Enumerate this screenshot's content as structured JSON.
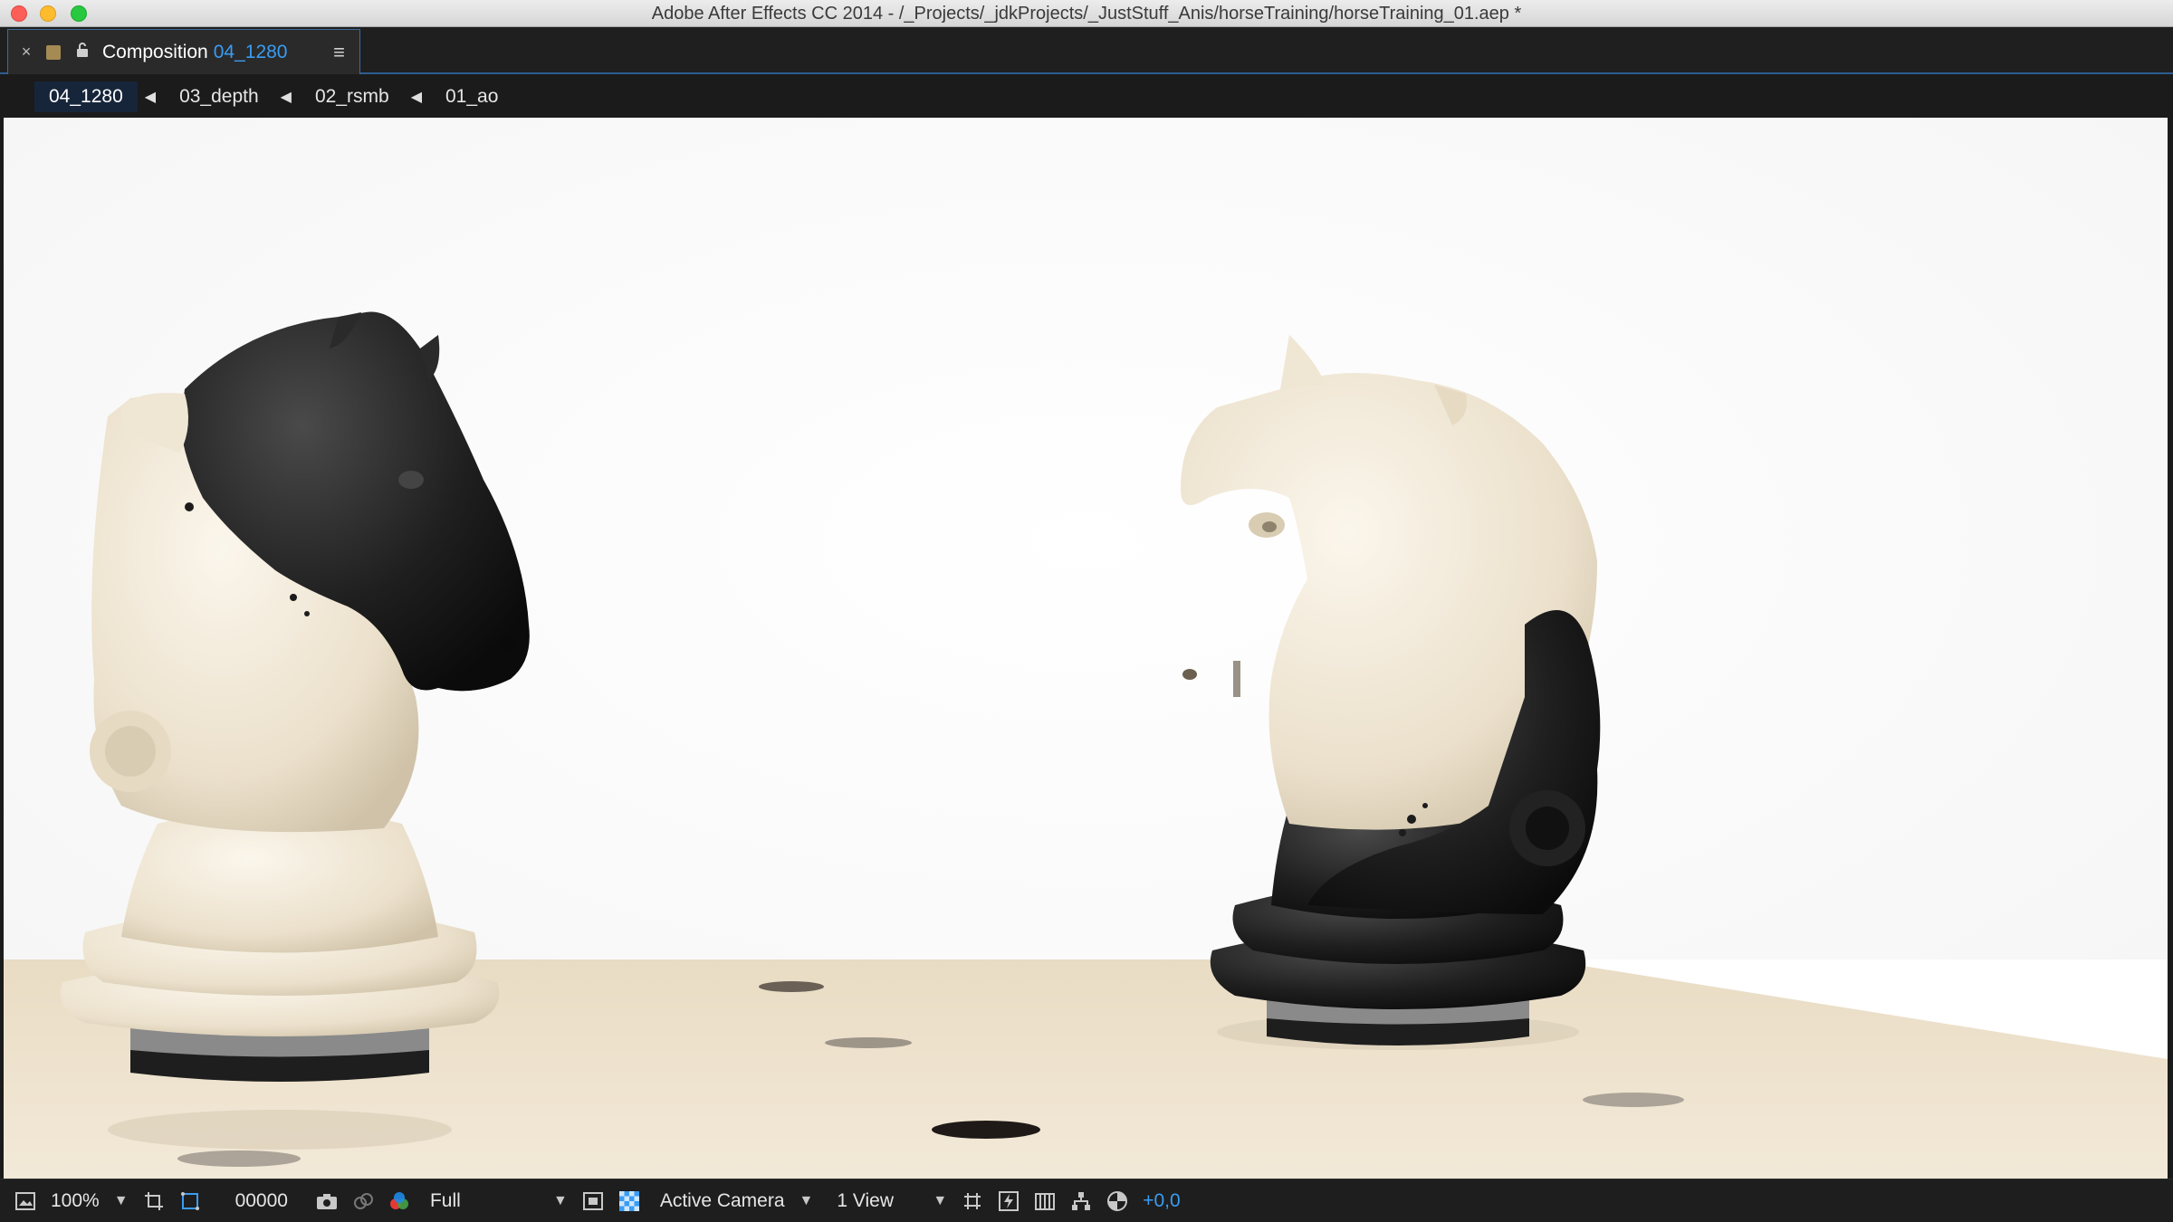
{
  "window": {
    "title": "Adobe After Effects CC 2014 - /_Projects/_jdkProjects/_JustStuff_Anis/horseTraining/horseTraining_01.aep *"
  },
  "panel": {
    "tab_label": "Composition",
    "comp_name": "04_1280",
    "close_glyph": "×",
    "menu_glyph": "≡"
  },
  "breadcrumb": {
    "items": [
      "04_1280",
      "03_depth",
      "02_rsmb",
      "01_ao"
    ]
  },
  "toolbar": {
    "magnification": "100%",
    "timecode": "00000",
    "resolution": "Full",
    "camera": "Active Camera",
    "views": "1 View",
    "exposure": "+0,0"
  },
  "colors": {
    "accent": "#3a9cf2",
    "panel_bg": "#1f1f1f",
    "viewer_bg": "#ffffff",
    "ivory": "#efe6d4",
    "ebony": "#1c1c1c",
    "board": "#efe3cd"
  },
  "icons": {
    "composition-icon": "▣",
    "lock-icon": "🔓",
    "region-icon": "⊞",
    "mask-icon": "⬚",
    "snapshot-icon": "📷",
    "channels-icon": "●"
  }
}
